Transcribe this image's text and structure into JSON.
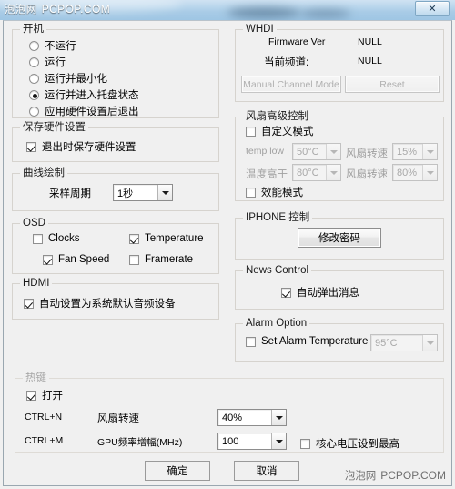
{
  "watermark": {
    "cn": "泡泡网",
    "en": "PCPOP.COM"
  },
  "titlebar": {
    "close_label": "✕"
  },
  "startup": {
    "legend": "开机",
    "options": [
      {
        "label": "不运行",
        "checked": false
      },
      {
        "label": "运行",
        "checked": false
      },
      {
        "label": "运行并最小化",
        "checked": false
      },
      {
        "label": "运行并进入托盘状态",
        "checked": true
      },
      {
        "label": "应用硬件设置后退出",
        "checked": false
      }
    ]
  },
  "save_hw": {
    "legend": "保存硬件设置",
    "checkbox": {
      "label": "退出时保存硬件设置",
      "checked": true
    }
  },
  "curve": {
    "legend": "曲线绘制",
    "label": "采样周期",
    "value": "1秒"
  },
  "osd": {
    "legend": "OSD",
    "items": [
      {
        "label": "Clocks",
        "checked": false
      },
      {
        "label": "Temperature",
        "checked": true
      },
      {
        "label": "Fan Speed",
        "checked": true
      },
      {
        "label": "Framerate",
        "checked": false
      }
    ]
  },
  "hdmi": {
    "legend": "HDMI",
    "checkbox": {
      "label": "自动设置为系统默认音频设备",
      "checked": true
    }
  },
  "whdi": {
    "legend": "WHDI",
    "firmware_label": "Firmware Ver",
    "firmware_value": "NULL",
    "channel_label": "当前频道:",
    "channel_value": "NULL",
    "manual_button": "Manual Channel Mode",
    "reset_button": "Reset"
  },
  "fan": {
    "legend": "风扇高级控制",
    "custom_mode": {
      "label": "自定义模式",
      "checked": false
    },
    "row1": {
      "temp_label": "temp low",
      "temp_value": "50°C",
      "speed_label": "风扇转速",
      "speed_value": "15%"
    },
    "row2": {
      "temp_label": "温度高于",
      "temp_value": "80°C",
      "speed_label": "风扇转速",
      "speed_value": "80%"
    },
    "perf_mode": {
      "label": "效能模式",
      "checked": false
    }
  },
  "iphone": {
    "legend": "IPHONE 控制",
    "button": "修改密码"
  },
  "news": {
    "legend": "News Control",
    "checkbox": {
      "label": "自动弹出消息",
      "checked": true
    }
  },
  "alarm": {
    "legend": "Alarm Option",
    "checkbox": {
      "label": "Set Alarm Temperature",
      "checked": false
    },
    "value": "95°C"
  },
  "hotkeys": {
    "legend": "热键",
    "enable": {
      "label": "打开",
      "checked": true
    },
    "rows": [
      {
        "key": "CTRL+N",
        "label": "风扇转速",
        "value": "40%"
      },
      {
        "key": "CTRL+M",
        "label": "GPU频率增幅(MHz)",
        "value": "100"
      }
    ],
    "max_voltage": {
      "label": "核心电压设到最高",
      "checked": false
    }
  },
  "footer": {
    "ok": "确定",
    "cancel": "取消"
  }
}
